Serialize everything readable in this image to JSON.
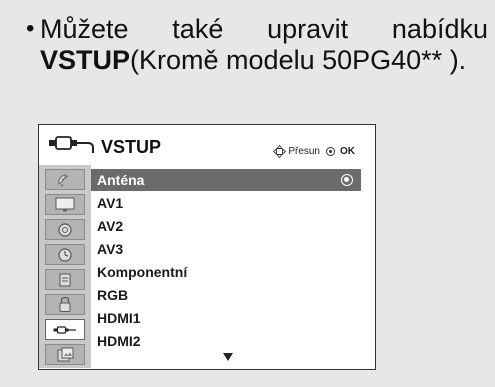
{
  "intro": {
    "bullet": "•",
    "line1": "Můžete také upravit nabídku",
    "line2_bold": "VSTUP",
    "line2_rest": "(Kromě modelu 50PG40** )."
  },
  "menu": {
    "title": "VSTUP",
    "hint_move": "Přesun",
    "hint_ok": "OK",
    "items": [
      {
        "label": "Anténa",
        "selected": true
      },
      {
        "label": "AV1"
      },
      {
        "label": "AV2"
      },
      {
        "label": "AV3"
      },
      {
        "label": "Komponentní"
      },
      {
        "label": "RGB"
      },
      {
        "label": "HDMI1"
      },
      {
        "label": "HDMI2"
      }
    ],
    "sidebar_icons": [
      "satellite-dish-icon",
      "picture-icon",
      "sound-icon",
      "time-icon",
      "option-icon",
      "lock-icon",
      "input-icon",
      "usb-photo-icon"
    ],
    "active_sidebar": "input-icon"
  },
  "colors": {
    "selection": "#6b6b6b",
    "sidebar": "#c9c9c9",
    "panel_background": "#e7e7e7"
  }
}
